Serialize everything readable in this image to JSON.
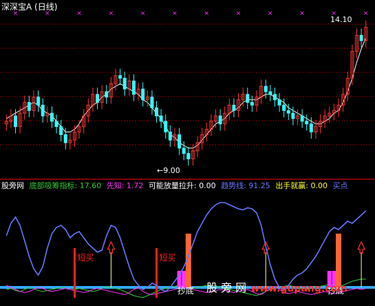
{
  "title": "深深宝A (日线)",
  "price_labels": {
    "high": "14.10",
    "low": "9.00",
    "low_arrow": "←"
  },
  "indicator": {
    "site": "股旁网",
    "items": [
      {
        "label": "底部吸筹指标:",
        "value": "17.60",
        "color": "#33cc33"
      },
      {
        "label": "先知:",
        "value": "1.72",
        "color": "#ff33ff"
      },
      {
        "label": "可能放量拉升:",
        "value": "0.00",
        "color": "#ffffff"
      },
      {
        "label": "趋势线:",
        "value": "91.25",
        "color": "#6677ff"
      },
      {
        "label": "出手就赢:",
        "value": "0.00",
        "color": "#ffff33"
      },
      {
        "label": "买点",
        "value": "",
        "color": "#6677ff"
      }
    ]
  },
  "annotations": {
    "short_buy": "短买",
    "bottom_catch": "抄底"
  },
  "watermark": {
    "text": "股 旁 网",
    "site": "www.gupang.com"
  },
  "colors": {
    "up": "#ff3333",
    "down": "#33ffff",
    "trend": "#6677ff",
    "baseline": "#33aaff",
    "grid": "#8b0000",
    "red_bar": "#ff2222",
    "orange_bar": "#ff6633",
    "magenta_bar": "#ff33ff",
    "marker": "#ff33ff",
    "arrow": "#ff3333",
    "stem": "#ffffaa"
  },
  "chart_data": [
    {
      "type": "candlestick",
      "title": "深深宝A (日线)",
      "ylim": [
        8.7,
        14.6
      ],
      "high_label": 14.1,
      "low_label": 9.0,
      "closes": [
        10.6,
        10.8,
        10.4,
        10.9,
        11.3,
        11.0,
        11.5,
        11.2,
        10.8,
        10.9,
        10.6,
        10.4,
        10.1,
        9.8,
        9.9,
        10.2,
        10.4,
        10.8,
        11.2,
        11.6,
        11.3,
        11.7,
        11.5,
        12.0,
        12.3,
        12.2,
        11.8,
        12.1,
        11.6,
        11.8,
        11.4,
        11.5,
        11.1,
        10.8,
        10.6,
        10.2,
        9.9,
        10.1,
        9.6,
        9.4,
        9.2,
        9.5,
        9.8,
        10.1,
        10.3,
        10.6,
        10.8,
        10.5,
        10.9,
        11.2,
        11.0,
        11.4,
        11.6,
        11.3,
        11.2,
        11.5,
        11.9,
        11.7,
        11.6,
        11.4,
        11.2,
        11.0,
        10.9,
        10.7,
        10.8,
        10.6,
        10.5,
        10.2,
        10.4,
        10.6,
        10.8,
        10.9,
        11.0,
        11.2,
        11.6,
        12.2,
        13.2,
        13.8,
        13.6,
        14.1
      ],
      "ma": [
        10.7,
        10.8,
        10.9,
        11.0,
        11.1,
        11.2,
        11.3,
        11.2,
        11.0,
        10.9,
        10.8,
        10.6,
        10.4,
        10.2,
        10.2,
        10.3,
        10.5,
        10.8,
        11.0,
        11.2,
        11.3,
        11.5,
        11.6,
        11.8,
        11.9,
        12.0,
        11.9,
        11.8,
        11.7,
        11.6,
        11.4,
        11.3,
        11.1,
        10.9,
        10.7,
        10.4,
        10.1,
        10.0,
        9.8,
        9.7,
        9.6,
        9.6,
        9.7,
        9.9,
        10.1,
        10.3,
        10.5,
        10.6,
        10.7,
        10.9,
        11.0,
        11.1,
        11.3,
        11.4,
        11.4,
        11.4,
        11.5,
        11.6,
        11.6,
        11.5,
        11.4,
        11.3,
        11.1,
        11.0,
        10.9,
        10.8,
        10.7,
        10.6,
        10.5,
        10.5,
        10.6,
        10.7,
        10.9,
        11.0,
        11.3,
        11.7,
        12.2,
        12.8,
        13.3,
        13.7
      ]
    },
    {
      "type": "indicator",
      "ylim": [
        0,
        100
      ],
      "trend_line": [
        60,
        72,
        78,
        70,
        55,
        40,
        28,
        22,
        30,
        48,
        62,
        68,
        70,
        66,
        58,
        62,
        64,
        58,
        52,
        48,
        44,
        46,
        60,
        70,
        68,
        58,
        44,
        30,
        18,
        12,
        8,
        10,
        14,
        12,
        8,
        6,
        10,
        16,
        22,
        30,
        40,
        52,
        64,
        72,
        80,
        86,
        90,
        92,
        92,
        90,
        88,
        86,
        85,
        87,
        86,
        82,
        70,
        50,
        32,
        18,
        10,
        8,
        12,
        18,
        22,
        24,
        28,
        34,
        40,
        48,
        56,
        64,
        68,
        66,
        70,
        74,
        72,
        76,
        80,
        84
      ],
      "baseline": 10,
      "green_line": [
        8,
        9,
        7,
        6,
        8,
        10,
        9,
        7,
        6,
        7,
        8,
        9,
        10,
        9,
        8,
        8,
        9,
        8,
        7,
        6,
        7,
        9,
        11,
        10,
        9,
        8,
        6,
        4,
        2,
        1,
        0,
        2,
        4,
        6,
        8,
        9,
        10,
        11,
        12,
        11,
        10,
        9,
        10,
        11,
        12,
        12,
        11,
        10,
        9,
        8,
        7,
        6,
        5,
        4,
        3,
        2,
        4,
        6,
        8,
        9,
        10,
        11,
        12,
        11,
        10,
        9,
        8,
        9,
        10,
        11,
        12,
        13,
        12,
        11,
        12,
        14,
        16,
        17,
        18,
        18
      ],
      "magenta_line": [
        12,
        10,
        8,
        6,
        5,
        6,
        8,
        10,
        9,
        7,
        6,
        7,
        8,
        9,
        8,
        7,
        6,
        5,
        6,
        8,
        9,
        8,
        7,
        6,
        5,
        4,
        3,
        5,
        8,
        10,
        6,
        4,
        3,
        4,
        5,
        6,
        7,
        8,
        9,
        10,
        9,
        8,
        7,
        6,
        5,
        6,
        7,
        8,
        7,
        6,
        5,
        6,
        7,
        8,
        6,
        4,
        3,
        6,
        9,
        11,
        8,
        5,
        4,
        5,
        6,
        5,
        4,
        3,
        4,
        5,
        6,
        5,
        4,
        5,
        6,
        7,
        8,
        9,
        8,
        9
      ],
      "red_bars": [
        15,
        33
      ],
      "orange_bars": [
        40,
        73
      ],
      "magenta_bars": [
        38,
        39,
        71,
        72
      ],
      "buy_arrows": [
        23,
        57,
        89
      ]
    }
  ]
}
